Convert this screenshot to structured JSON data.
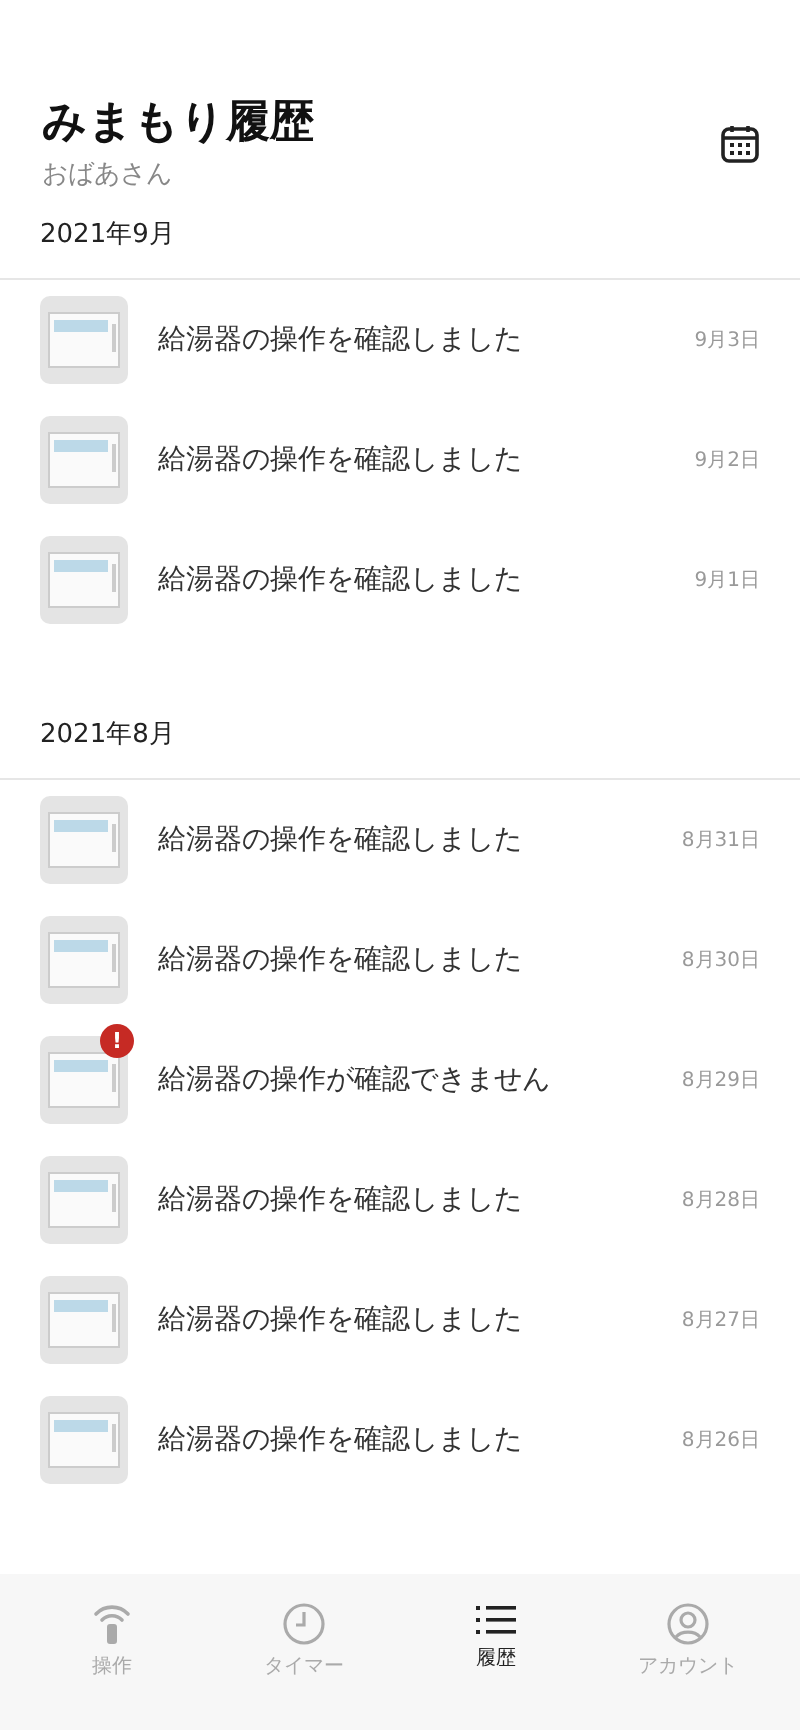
{
  "header": {
    "title": "みまもり履歴",
    "subtitle": "おばあさん"
  },
  "sections": [
    {
      "month": "2021年9月",
      "items": [
        {
          "message": "給湯器の操作を確認しました",
          "date": "9月3日"
        },
        {
          "message": "給湯器の操作を確認しました",
          "date": "9月2日"
        },
        {
          "message": "給湯器の操作を確認しました",
          "date": "9月1日"
        }
      ]
    },
    {
      "month": "2021年8月",
      "items": [
        {
          "message": "給湯器の操作を確認しました",
          "date": "8月31日"
        },
        {
          "message": "給湯器の操作を確認しました",
          "date": "8月30日"
        },
        {
          "message": "給湯器の操作が確認できません",
          "date": "8月29日",
          "badge": "!"
        },
        {
          "message": "給湯器の操作を確認しました",
          "date": "8月28日"
        },
        {
          "message": "給湯器の操作を確認しました",
          "date": "8月27日"
        },
        {
          "message": "給湯器の操作を確認しました",
          "date": "8月26日"
        }
      ]
    }
  ],
  "tabs": [
    {
      "kind": "remote",
      "label": "操作",
      "selected": false
    },
    {
      "kind": "timer",
      "label": "タイマー",
      "selected": false
    },
    {
      "kind": "history",
      "label": "履歴",
      "selected": true
    },
    {
      "kind": "account",
      "label": "アカウント",
      "selected": false
    }
  ]
}
